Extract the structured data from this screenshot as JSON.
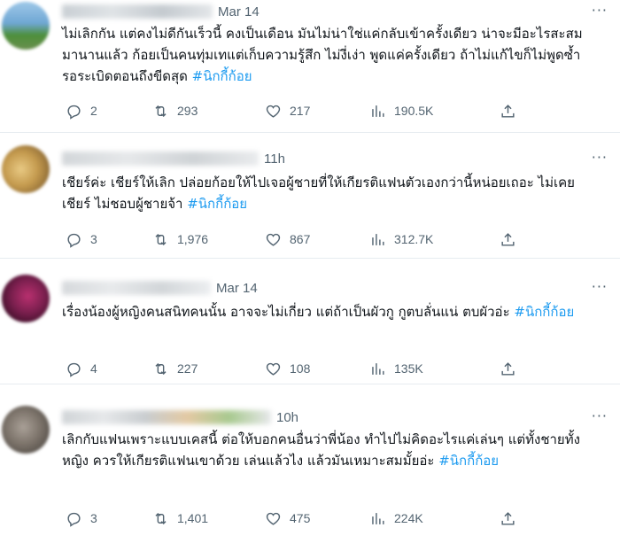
{
  "tweets": [
    {
      "time": "Mar 14",
      "text": "ไม่เลิกกัน แต่คงไม่ดีกันเร็วนี้ คงเป็นเดือน มันไม่น่าใช่แค่กลับเข้าครั้งเดียว น่าจะมีอะไรสะสมมานานแล้ว ก้อยเป็นคนทุ่มเทแต่เก็บความรู้สึก ไม่งี่เง่า พูดแค่ครั้งเดียว ถ้าไม่แก้ไขก็ไม่พูดซ้ำ รอระเบิดตอนถึงขีดสุด ",
      "hashtag": "#นิกกี้ก้อย",
      "replies": "2",
      "retweets": "293",
      "likes": "217",
      "views": "190.5K"
    },
    {
      "time": "11h",
      "text": "เชียร์ค่ะ เชียร์ให้เลิก ปล่อยก้อยให้ไปเจอผู้ชายที่ให้เกียรติแฟนตัวเองกว่านี้หน่อยเถอะ ไม่เคยเชียร์ ไม่ชอบผู้ชายจ้า ",
      "hashtag": "#นิกกี้ก้อย",
      "replies": "3",
      "retweets": "1,976",
      "likes": "867",
      "views": "312.7K"
    },
    {
      "time": "Mar 14",
      "text": "เรื่องน้องผู้หญิงคนสนิทคนนั้น อาจจะไม่เกี่ยว แต่ถ้าเป็นผัวกู กูตบลั่นแน่ ตบผัวอ่ะ ",
      "hashtag": "#นิกกี้ก้อย",
      "replies": "4",
      "retweets": "227",
      "likes": "108",
      "views": "135K"
    },
    {
      "time": "10h",
      "text": "เลิกกับแฟนเพราะแบบเคสนี้ ต่อให้บอกคนอื่นว่าพี่น้อง ทำไปไม่คิดอะไรแค่เล่นๆ แต่ทั้งชายทั้งหญิง ควรให้เกียรติแฟนเขาด้วย เล่นแล้วไง แล้วมันเหมาะสมมั้ยอ่ะ ",
      "hashtag": "#นิกกี้ก้อย",
      "replies": "3",
      "retweets": "1,401",
      "likes": "475",
      "views": "224K"
    }
  ],
  "more_label": "···",
  "icons": {
    "reply": "reply-icon",
    "retweet": "retweet-icon",
    "like": "heart-icon",
    "views": "views-icon",
    "share": "share-icon"
  },
  "colors": {
    "hashtag": "#1d9bf0",
    "meta": "#536471",
    "text": "#0f1419"
  }
}
